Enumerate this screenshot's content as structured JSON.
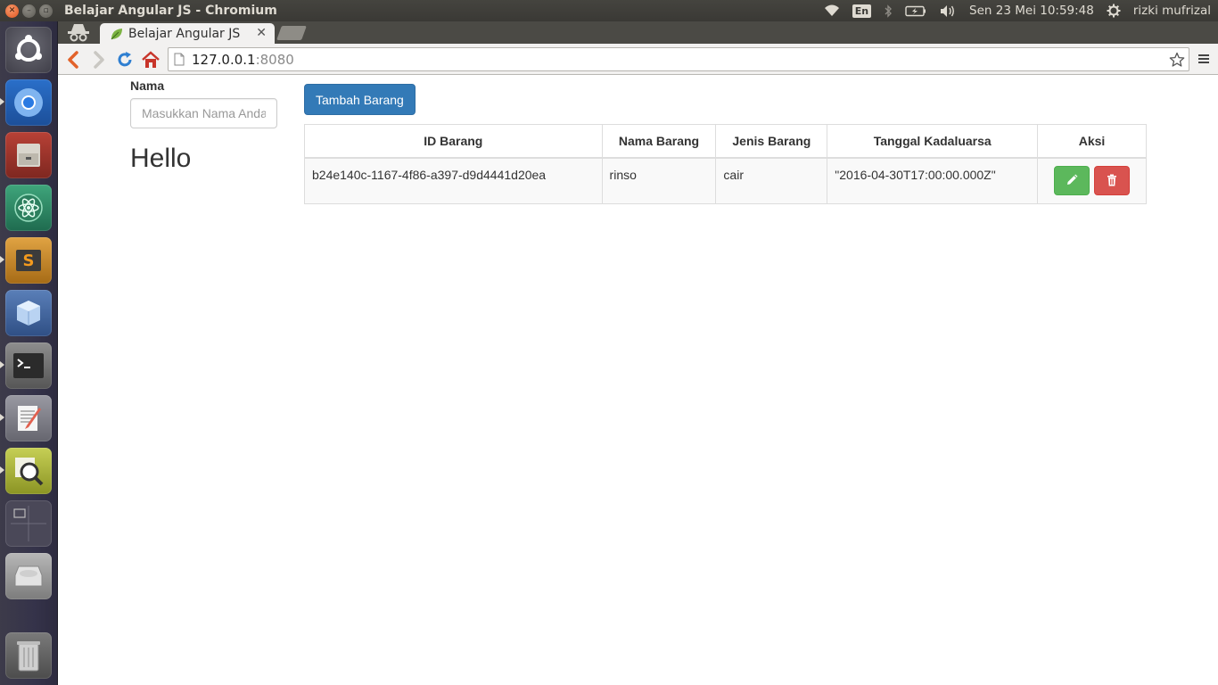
{
  "panel": {
    "window_title": "Belajar Angular JS - Chromium",
    "keyboard_layout": "En",
    "clock": "Sen 23 Mei 10:59:48",
    "user": "rizki mufrizal"
  },
  "launcher": {
    "items": [
      "ubuntu-dash",
      "chromium",
      "files",
      "atom",
      "sublime-text",
      "virtualbox",
      "terminal",
      "text-editor",
      "system-monitor",
      "workspace-switcher",
      "disk",
      "trash"
    ]
  },
  "browser": {
    "tab_title": "Belajar Angular JS",
    "url_host": "127.0.0.1",
    "url_port": ":8080"
  },
  "form": {
    "label": "Nama",
    "placeholder": "Masukkan Nama Anda",
    "greeting": "Hello"
  },
  "toolbar": {
    "add_label": "Tambah Barang"
  },
  "table": {
    "headers": {
      "id": "ID Barang",
      "nama": "Nama Barang",
      "jenis": "Jenis Barang",
      "tanggal": "Tanggal Kadaluarsa",
      "aksi": "Aksi"
    },
    "rows": [
      {
        "id": "b24e140c-1167-4f86-a397-d9d4441d20ea",
        "nama": "rinso",
        "jenis": "cair",
        "tanggal": "\"2016-04-30T17:00:00.000Z\""
      }
    ]
  },
  "colors": {
    "primary": "#337ab7",
    "success": "#5cb85c",
    "danger": "#d9534f"
  }
}
